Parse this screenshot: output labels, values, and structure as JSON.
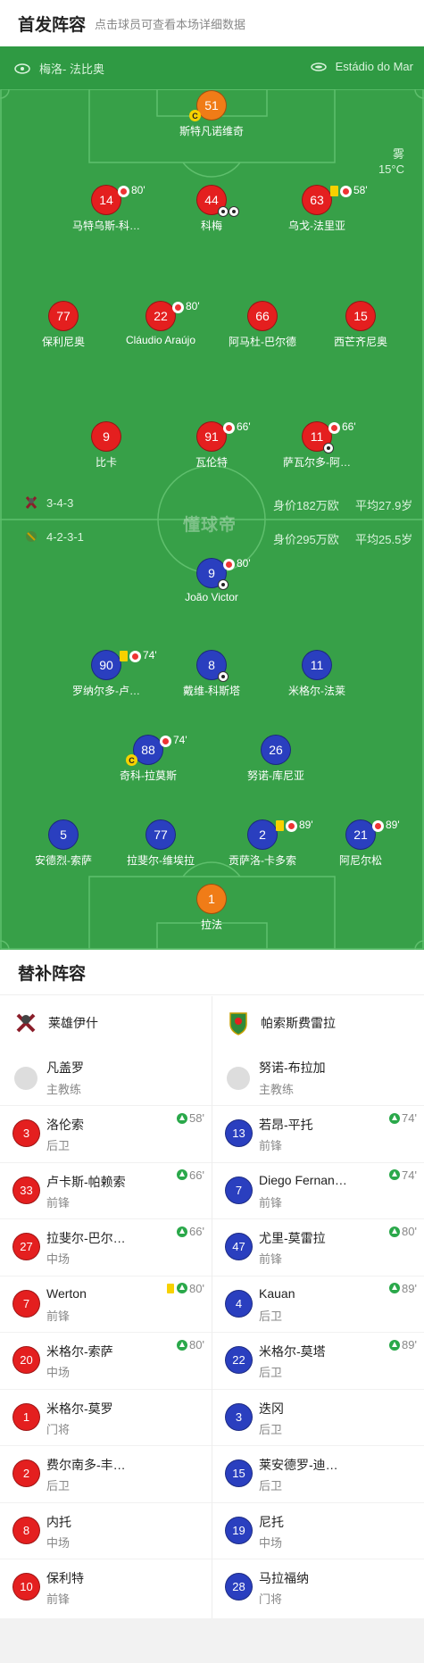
{
  "header": {
    "title": "首发阵容",
    "subtitle": "点击球员可查看本场详细数据"
  },
  "pitch": {
    "home_team": "梅洛- 法比奥",
    "away_team": "Estádio do Mar",
    "weather": {
      "condition": "雾",
      "temperature": "15°C"
    },
    "watermark": "懂球帝",
    "home_formation": {
      "formation": "3-4-3",
      "value": "身价182万欧",
      "avg_age": "平均27.9岁"
    },
    "away_formation": {
      "formation": "4-2-3-1",
      "value": "身价295万欧",
      "avg_age": "平均25.5岁"
    },
    "home_players": [
      {
        "number": "51",
        "name": "斯特凡诺维奇",
        "captain": "C"
      },
      {
        "number": "14",
        "name": "马特乌斯-科…",
        "sub_min": "80'"
      },
      {
        "number": "44",
        "name": "科梅"
      },
      {
        "number": "63",
        "name": "乌戈-法里亚",
        "sub_min": "58'"
      },
      {
        "number": "77",
        "name": "保利尼奥"
      },
      {
        "number": "22",
        "name": "Cláudio Araújo",
        "sub_min": "80'"
      },
      {
        "number": "66",
        "name": "阿马杜-巴尔德"
      },
      {
        "number": "15",
        "name": "西芒齐尼奥"
      },
      {
        "number": "9",
        "name": "比卡"
      },
      {
        "number": "91",
        "name": "瓦伦特",
        "sub_min": "66'"
      },
      {
        "number": "11",
        "name": "萨瓦尔多-阿…",
        "sub_min": "66'"
      }
    ],
    "away_players": [
      {
        "number": "9",
        "name": "João Victor",
        "sub_min": "80'"
      },
      {
        "number": "90",
        "name": "罗纳尔多-卢…",
        "sub_min": "74'"
      },
      {
        "number": "8",
        "name": "戴维-科斯塔"
      },
      {
        "number": "11",
        "name": "米格尔-法莱"
      },
      {
        "number": "88",
        "name": "奇科-拉莫斯",
        "sub_min": "74'",
        "captain": "C"
      },
      {
        "number": "26",
        "name": "努诺-库尼亚"
      },
      {
        "number": "5",
        "name": "安德烈-索萨"
      },
      {
        "number": "77",
        "name": "拉斐尔-维埃拉"
      },
      {
        "number": "2",
        "name": "贡萨洛-卡多索",
        "sub_min": "89'"
      },
      {
        "number": "21",
        "name": "阿尼尔松",
        "sub_min": "89'"
      },
      {
        "number": "1",
        "name": "拉法"
      }
    ]
  },
  "bench": {
    "title": "替补阵容",
    "home": {
      "team": "莱雄伊什",
      "coach": {
        "name": "凡盖罗",
        "role": "主教练"
      },
      "subs": [
        {
          "number": "3",
          "name": "洛伦索",
          "position": "后卫",
          "in": "58'"
        },
        {
          "number": "33",
          "name": "卢卡斯-帕赖索",
          "position": "前锋",
          "in": "66'"
        },
        {
          "number": "27",
          "name": "拉斐尔-巴尔…",
          "position": "中场",
          "in": "66'"
        },
        {
          "number": "7",
          "name": "Werton",
          "position": "前锋",
          "in": "80'"
        },
        {
          "number": "20",
          "name": "米格尔-索萨",
          "position": "中场",
          "in": "80'"
        },
        {
          "number": "1",
          "name": "米格尔-莫罗",
          "position": "门将"
        },
        {
          "number": "2",
          "name": "费尔南多-丰…",
          "position": "后卫"
        },
        {
          "number": "8",
          "name": "内托",
          "position": "中场"
        },
        {
          "number": "10",
          "name": "保利特",
          "position": "前锋"
        }
      ]
    },
    "away": {
      "team": "帕索斯费雷拉",
      "coach": {
        "name": "努诺-布拉加",
        "role": "主教练"
      },
      "subs": [
        {
          "number": "13",
          "name": "若昂-平托",
          "position": "前锋",
          "in": "74'"
        },
        {
          "number": "7",
          "name": "Diego Fernan…",
          "position": "前锋",
          "in": "74'"
        },
        {
          "number": "47",
          "name": "尤里-莫雷拉",
          "position": "前锋",
          "in": "80'"
        },
        {
          "number": "4",
          "name": "Kauan",
          "position": "后卫",
          "in": "89'"
        },
        {
          "number": "22",
          "name": "米格尔-莫塔",
          "position": "后卫",
          "in": "89'"
        },
        {
          "number": "3",
          "name": "迭冈",
          "position": "后卫"
        },
        {
          "number": "15",
          "name": "莱安德罗-迪…",
          "position": "后卫"
        },
        {
          "number": "19",
          "name": "尼托",
          "position": "中场"
        },
        {
          "number": "28",
          "name": "马拉福纳",
          "position": "门将"
        }
      ]
    }
  },
  "colors": {
    "pitch": "#37a048",
    "home": "#e41f1f",
    "away": "#2a3fbf",
    "goalkeeper": "#f07c17",
    "sub_in": "#2aa84a",
    "yellow_card": "#f7d100"
  },
  "icons": [
    "jersey-icon",
    "stadium-icon",
    "sub-out-icon",
    "sub-in-icon",
    "ball-icon",
    "yellow-card-icon",
    "captain-badge",
    "coach-avatar-icon",
    "team-logo"
  ]
}
